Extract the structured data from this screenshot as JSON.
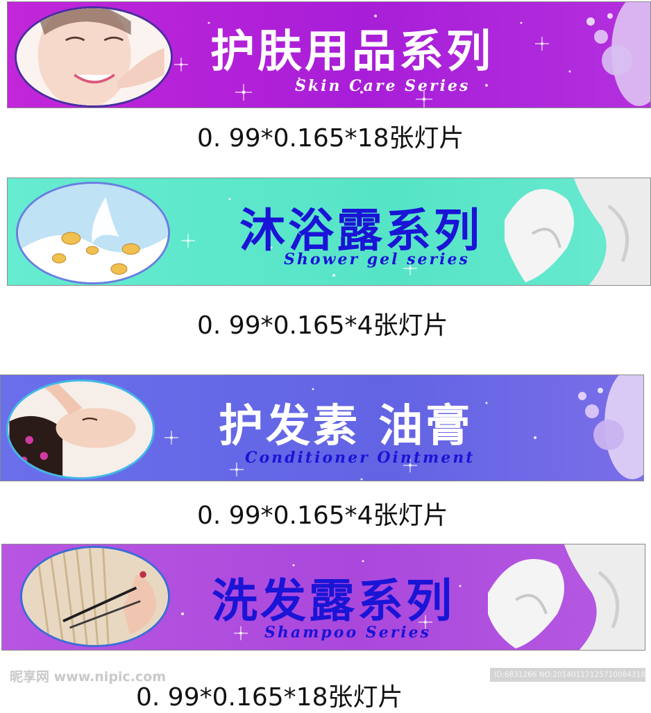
{
  "banners": [
    {
      "title": "护肤用品系列",
      "subtitle": "Skin Care Series",
      "caption": "0. 99*0.165*18张灯片",
      "image": "woman-face-icon"
    },
    {
      "title": "沐浴露系列",
      "subtitle": "Shower gel series",
      "caption": "0. 99*0.165*4张灯片",
      "image": "milk-splash-icon"
    },
    {
      "title": "护发素 油膏",
      "subtitle": "Conditioner  Ointment",
      "caption": "0. 99*0.165*4张灯片",
      "image": "head-massage-icon"
    },
    {
      "title": "洗发露系列",
      "subtitle": "Shampoo Series",
      "caption": "0. 99*0.165*18张灯片",
      "image": "hair-cut-icon"
    }
  ],
  "colors": {
    "banner1_bg": "#b21fd6",
    "banner2_bg": "#5ee8c9",
    "banner3_bg": "#6a6de8",
    "banner4_bg": "#b44ee0",
    "title_white": "#ffffff",
    "title_blue": "#1a14d6"
  },
  "watermark": {
    "left": "昵享网 www.nipic.com",
    "right": "ID:6831266 NO:20140117125710084318"
  }
}
